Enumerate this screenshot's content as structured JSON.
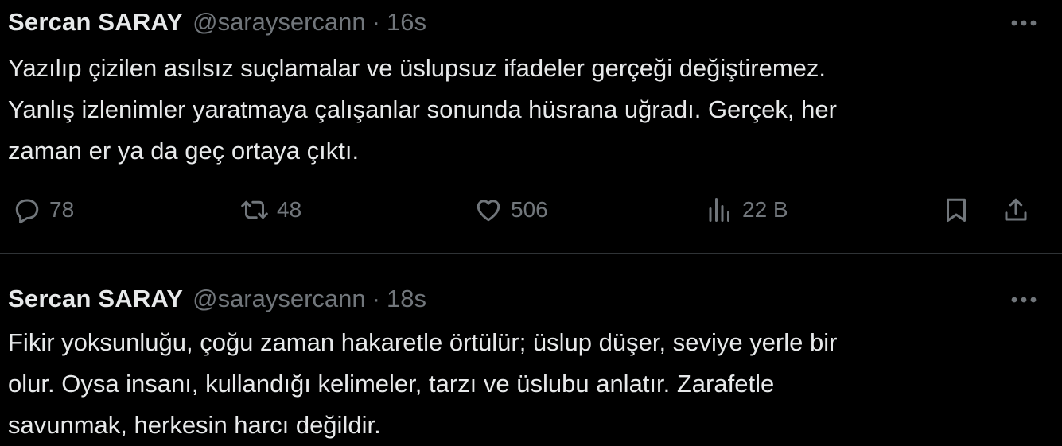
{
  "tweets": [
    {
      "display_name": "Sercan SARAY",
      "handle": "@saraysercann",
      "separator": "·",
      "time": "16s",
      "text_lines": [
        "Yazılıp çizilen asılsız suçlamalar ve üslupsuz ifadeler gerçeği değiştiremez.",
        "Yanlış izlenimler yaratmaya çalışanlar sonunda hüsrana uğradı. Gerçek, her",
        "zaman er ya da geç ortaya çıktı."
      ],
      "actions": {
        "reply": {
          "icon": "reply-icon",
          "count": "78"
        },
        "retweet": {
          "icon": "retweet-icon",
          "count": "48"
        },
        "like": {
          "icon": "like-icon",
          "count": "506"
        },
        "views": {
          "icon": "views-icon",
          "count": "22 B"
        },
        "bookmark": {
          "icon": "bookmark-icon"
        },
        "share": {
          "icon": "share-icon"
        }
      }
    },
    {
      "display_name": "Sercan SARAY",
      "handle": "@saraysercann",
      "separator": "·",
      "time": "18s",
      "text_lines": [
        "Fikir yoksunluğu, çoğu zaman hakaretle örtülür; üslup düşer, seviye yerle bir",
        "olur. Oysa insanı, kullandığı kelimeler, tarzı ve üslubu anlatır. Zarafetle",
        "savunmak, herkesin harcı değildir."
      ]
    }
  ],
  "colors": {
    "background": "#000000",
    "primary_text": "#e7e9ea",
    "secondary_text": "#71767b",
    "divider": "#2f3336"
  }
}
